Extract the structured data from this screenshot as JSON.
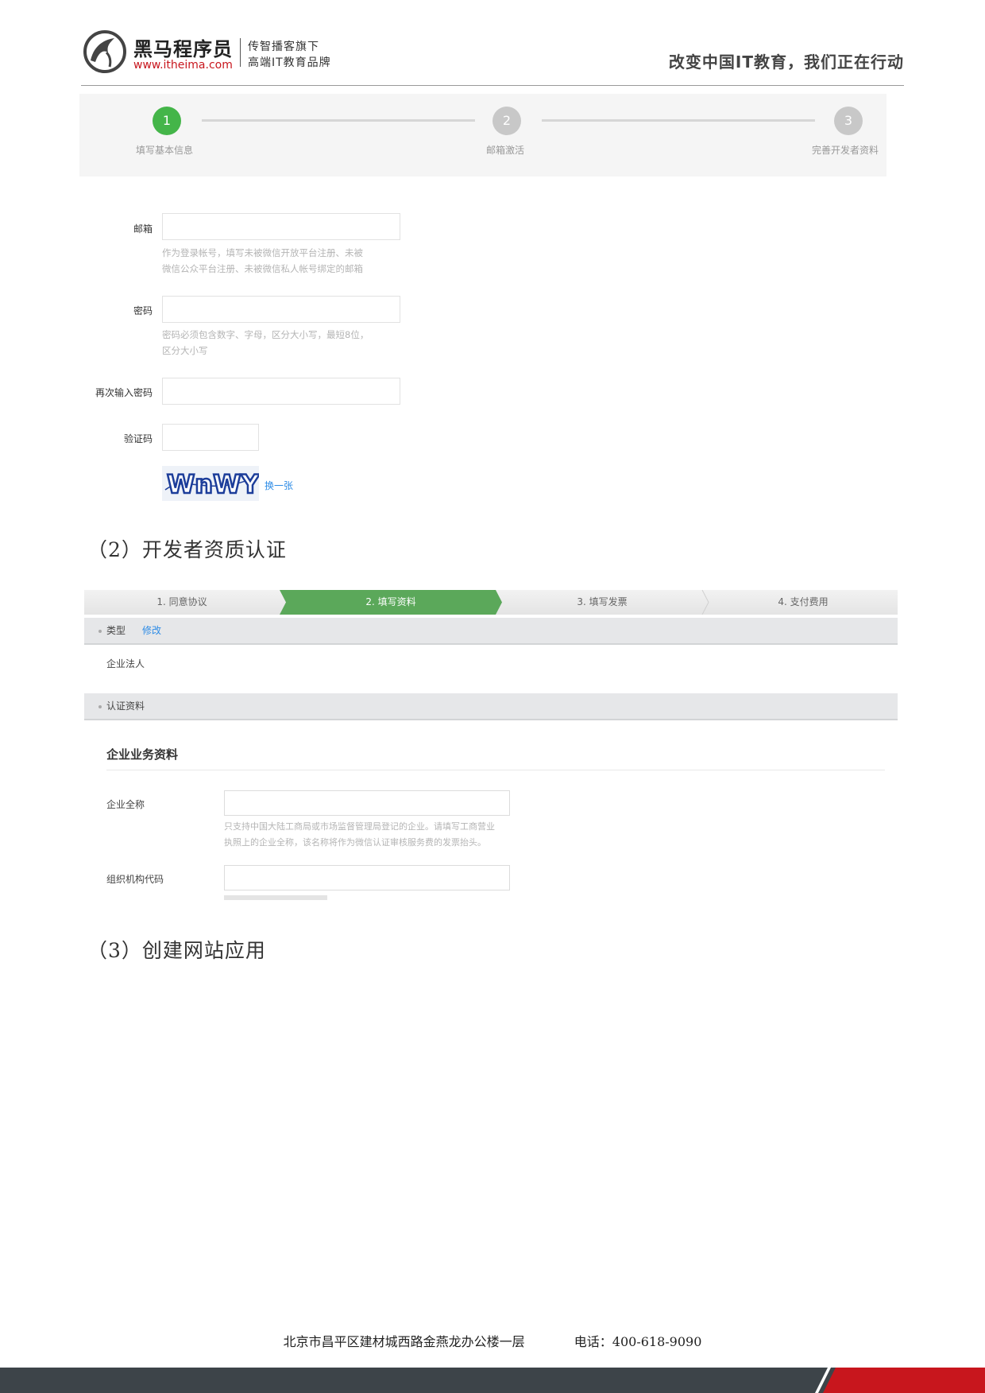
{
  "header": {
    "logo_name": "黑马程序员",
    "logo_url": "www.itheima.com",
    "logo_tag_line1": "传智播客旗下",
    "logo_tag_line2": "高端IT教育品牌",
    "slogan": "改变中国IT教育，我们正在行动"
  },
  "register": {
    "steps": [
      {
        "number": "1",
        "label": "填写基本信息",
        "active": true
      },
      {
        "number": "2",
        "label": "邮箱激活",
        "active": false
      },
      {
        "number": "3",
        "label": "完善开发者资料",
        "active": false
      }
    ],
    "email_label": "邮箱",
    "email_hint_line1": "作为登录帐号，填写未被微信开放平台注册、未被",
    "email_hint_line2": "微信公众平台注册、未被微信私人帐号绑定的邮箱",
    "password_label": "密码",
    "password_hint_line1": "密码必须包含数字、字母，区分大小写，最短8位，",
    "password_hint_line2": "区分大小写",
    "confirm_label": "再次输入密码",
    "captcha_label": "验证码",
    "captcha_text": "WnWY",
    "captcha_refresh": "换一张"
  },
  "section2": {
    "heading": "（2）开发者资质认证"
  },
  "verify": {
    "tabs": [
      "1. 同意协议",
      "2. 填写资料",
      "3. 填写发票",
      "4. 支付费用"
    ],
    "active_tab": 1,
    "type_label": "类型",
    "type_edit": "修改",
    "type_value": "企业法人",
    "info_label": "认证资料",
    "subheading": "企业业务资料",
    "company_name_label": "企业全称",
    "company_name_hint_line1": "只支持中国大陆工商局或市场监督管理局登记的企业。请填写工商营业",
    "company_name_hint_line2": "执照上的企业全称，该名称将作为微信认证审核服务费的发票抬头。",
    "org_code_label": "组织机构代码"
  },
  "section3": {
    "heading": "（3）创建网站应用"
  },
  "footer": {
    "address": "北京市昌平区建材城西路金燕龙办公楼一层",
    "phone": "电话：400-618-9090"
  },
  "colors": {
    "brand_red": "#c8161d",
    "step_green": "#44b549",
    "tab_green": "#5ba85a",
    "link_blue": "#2e8ce6",
    "footer_dark": "#3d4449"
  }
}
